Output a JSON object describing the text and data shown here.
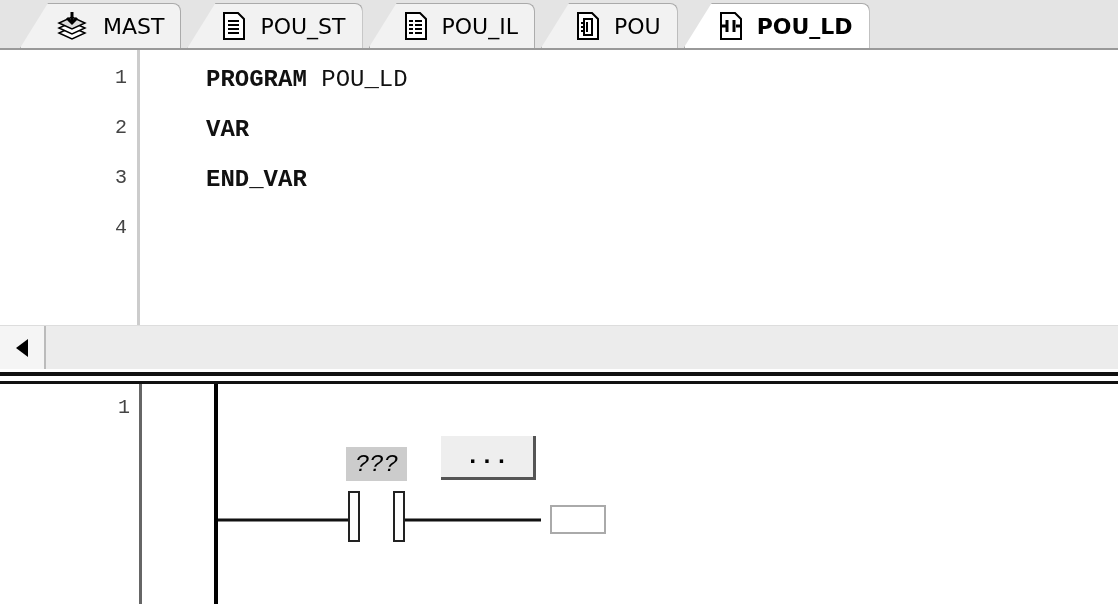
{
  "tabs": [
    {
      "label": "MAST",
      "kind": "stack",
      "selected": false
    },
    {
      "label": "POU_ST",
      "kind": "doc",
      "selected": false
    },
    {
      "label": "POU_IL",
      "kind": "list",
      "selected": false
    },
    {
      "label": "POU",
      "kind": "block",
      "selected": false
    },
    {
      "label": "POU_LD",
      "kind": "ladder",
      "selected": true
    }
  ],
  "editor": {
    "lines": [
      {
        "number": "1",
        "kind": "mixed",
        "text": "**PROGRAM** POU_LD"
      },
      {
        "number": "2",
        "kind": "keyword",
        "text": "VAR"
      },
      {
        "number": "3",
        "kind": "keyword",
        "text": "END_VAR"
      },
      {
        "number": "4"
      }
    ]
  },
  "ladder": {
    "rung_number": "1",
    "contact_label": "???",
    "browse_button": "..."
  }
}
